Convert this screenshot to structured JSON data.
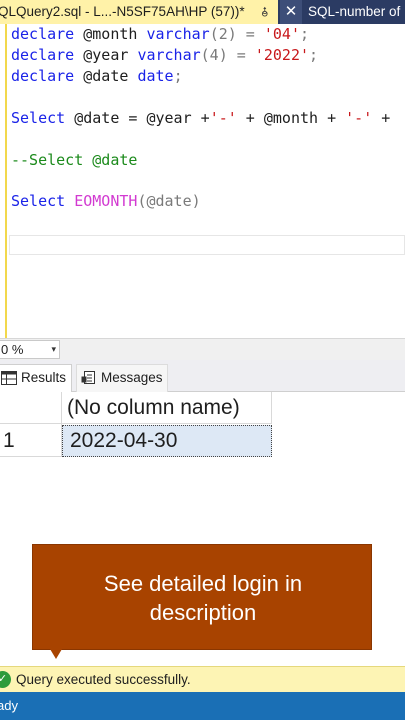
{
  "tabs": {
    "active_title": "QLQuery2.sql - L...-N5SF75AH\\HP (57))*",
    "pin_glyph": "⯗",
    "close_glyph": "✕",
    "inactive_title": "SQL-number of"
  },
  "code": {
    "line1": {
      "kw1": "declare",
      "v1": " @month ",
      "kw2": "varchar",
      "p1": "(2) = ",
      "s1": "'04'",
      "e": ";"
    },
    "line2": {
      "kw1": "declare",
      "v1": " @year ",
      "kw2": "varchar",
      "p1": "(4) = ",
      "s1": "'2022'",
      "e": ";"
    },
    "line3": {
      "kw1": "declare",
      "v1": " @date ",
      "kw2": "date",
      "e": ";"
    },
    "line4": {
      "kw1": "Select",
      "v1": " @date = @year +",
      "s1": "'-'",
      "v2": " + @month + ",
      "s2": "'-'",
      "v3": " +"
    },
    "line5": {
      "comment": "--Select @date"
    },
    "line6": {
      "kw1": "Select ",
      "fn": "EOMONTH",
      "p": "(@date)"
    }
  },
  "zoom": {
    "value": "0 %",
    "arrow": "▾"
  },
  "results_tabs": {
    "results": "Results",
    "messages": "Messages"
  },
  "grid": {
    "column_header": "(No column name)",
    "row_number": "1",
    "cell_value": "2022-04-30"
  },
  "callout": {
    "line1": "See detailed login in",
    "line2": "description"
  },
  "status": {
    "icon": "✓",
    "text": "Query executed successfully."
  },
  "footer": {
    "text": "ady"
  },
  "colors": {
    "tab_active": "#fff2a8",
    "tab_bar": "#2b3b63",
    "keyword": "#1a23e8",
    "string": "#c8181b",
    "function": "#d23ad1",
    "comment": "#1b8a1b",
    "callout": "#a84300",
    "status_bar": "#fdf4b4",
    "footer": "#1a6fb5"
  }
}
